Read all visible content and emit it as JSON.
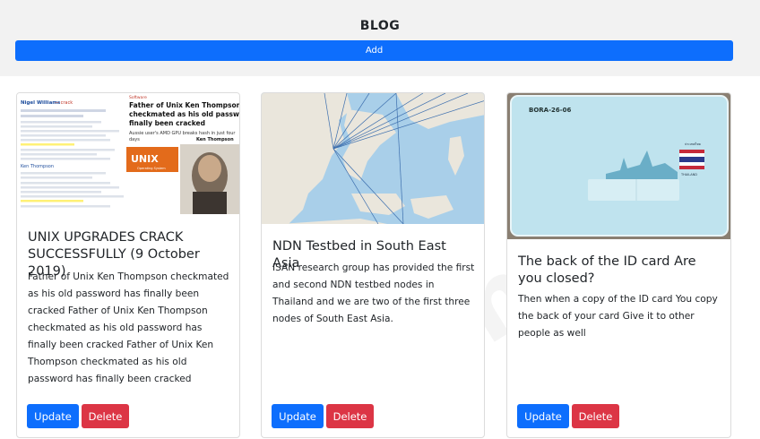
{
  "header": {
    "title": "BLOG",
    "add_label": "Add"
  },
  "posts": [
    {
      "title": "UNIX UPGRADES CRACK SUCCESSFULLY (9 October 2019)",
      "body": "Father of Unix Ken Thompson checkmated as his old password has finally been cracked Father of Unix Ken Thompson checkmated as his old password has finally been cracked Father of Unix Ken Thompson checkmated as his old password has finally been cracked",
      "update_label": "Update",
      "delete_label": "Delete",
      "image": {
        "headline": "Father of Unix Ken Thompson checkmated as his old password has finally been cracked",
        "subline": "Aussie user's AMD GPU breaks hash in just four days",
        "name": "Ken Thompson",
        "badge": "UNIX",
        "badge_sub": "Operating System",
        "header": "Nigel Williams",
        "category": "Software"
      }
    },
    {
      "title": "NDN Testbed in South East Asia",
      "body": "ISAN research group has provided the first and second NDN testbed nodes in Thailand and we are two of the first three nodes of South East Asia.",
      "update_label": "Update",
      "delete_label": "Delete"
    },
    {
      "title": "The back of the ID card Are you closed?",
      "body": "Then when a copy of the ID card You copy the back of your card Give it to other people as well",
      "update_label": "Update",
      "delete_label": "Delete",
      "image": {
        "card_code": "BORA-26-06",
        "country": "THAILAND"
      }
    }
  ]
}
